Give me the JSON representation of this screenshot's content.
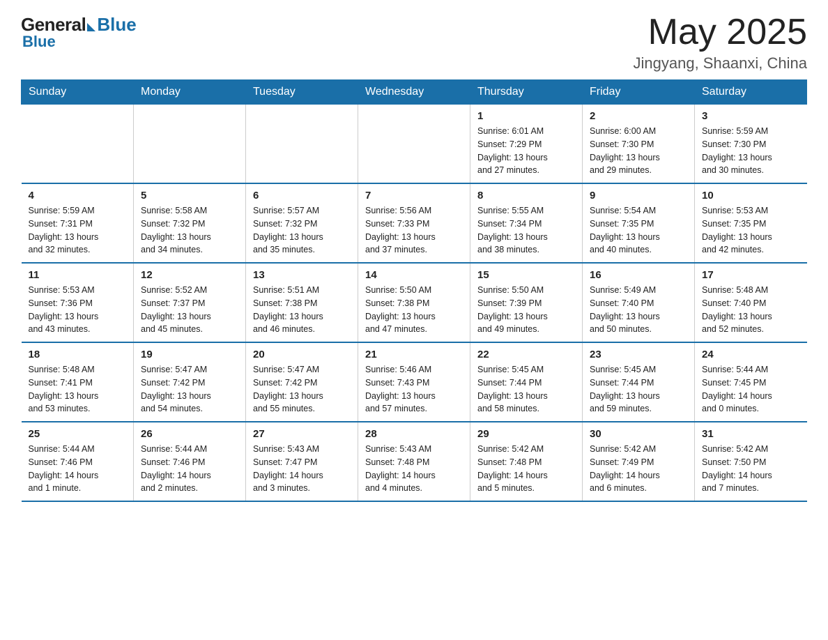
{
  "header": {
    "logo_general": "General",
    "logo_blue": "Blue",
    "month_year": "May 2025",
    "location": "Jingyang, Shaanxi, China"
  },
  "weekdays": [
    "Sunday",
    "Monday",
    "Tuesday",
    "Wednesday",
    "Thursday",
    "Friday",
    "Saturday"
  ],
  "weeks": [
    [
      {
        "day": "",
        "info": ""
      },
      {
        "day": "",
        "info": ""
      },
      {
        "day": "",
        "info": ""
      },
      {
        "day": "",
        "info": ""
      },
      {
        "day": "1",
        "info": "Sunrise: 6:01 AM\nSunset: 7:29 PM\nDaylight: 13 hours\nand 27 minutes."
      },
      {
        "day": "2",
        "info": "Sunrise: 6:00 AM\nSunset: 7:30 PM\nDaylight: 13 hours\nand 29 minutes."
      },
      {
        "day": "3",
        "info": "Sunrise: 5:59 AM\nSunset: 7:30 PM\nDaylight: 13 hours\nand 30 minutes."
      }
    ],
    [
      {
        "day": "4",
        "info": "Sunrise: 5:59 AM\nSunset: 7:31 PM\nDaylight: 13 hours\nand 32 minutes."
      },
      {
        "day": "5",
        "info": "Sunrise: 5:58 AM\nSunset: 7:32 PM\nDaylight: 13 hours\nand 34 minutes."
      },
      {
        "day": "6",
        "info": "Sunrise: 5:57 AM\nSunset: 7:32 PM\nDaylight: 13 hours\nand 35 minutes."
      },
      {
        "day": "7",
        "info": "Sunrise: 5:56 AM\nSunset: 7:33 PM\nDaylight: 13 hours\nand 37 minutes."
      },
      {
        "day": "8",
        "info": "Sunrise: 5:55 AM\nSunset: 7:34 PM\nDaylight: 13 hours\nand 38 minutes."
      },
      {
        "day": "9",
        "info": "Sunrise: 5:54 AM\nSunset: 7:35 PM\nDaylight: 13 hours\nand 40 minutes."
      },
      {
        "day": "10",
        "info": "Sunrise: 5:53 AM\nSunset: 7:35 PM\nDaylight: 13 hours\nand 42 minutes."
      }
    ],
    [
      {
        "day": "11",
        "info": "Sunrise: 5:53 AM\nSunset: 7:36 PM\nDaylight: 13 hours\nand 43 minutes."
      },
      {
        "day": "12",
        "info": "Sunrise: 5:52 AM\nSunset: 7:37 PM\nDaylight: 13 hours\nand 45 minutes."
      },
      {
        "day": "13",
        "info": "Sunrise: 5:51 AM\nSunset: 7:38 PM\nDaylight: 13 hours\nand 46 minutes."
      },
      {
        "day": "14",
        "info": "Sunrise: 5:50 AM\nSunset: 7:38 PM\nDaylight: 13 hours\nand 47 minutes."
      },
      {
        "day": "15",
        "info": "Sunrise: 5:50 AM\nSunset: 7:39 PM\nDaylight: 13 hours\nand 49 minutes."
      },
      {
        "day": "16",
        "info": "Sunrise: 5:49 AM\nSunset: 7:40 PM\nDaylight: 13 hours\nand 50 minutes."
      },
      {
        "day": "17",
        "info": "Sunrise: 5:48 AM\nSunset: 7:40 PM\nDaylight: 13 hours\nand 52 minutes."
      }
    ],
    [
      {
        "day": "18",
        "info": "Sunrise: 5:48 AM\nSunset: 7:41 PM\nDaylight: 13 hours\nand 53 minutes."
      },
      {
        "day": "19",
        "info": "Sunrise: 5:47 AM\nSunset: 7:42 PM\nDaylight: 13 hours\nand 54 minutes."
      },
      {
        "day": "20",
        "info": "Sunrise: 5:47 AM\nSunset: 7:42 PM\nDaylight: 13 hours\nand 55 minutes."
      },
      {
        "day": "21",
        "info": "Sunrise: 5:46 AM\nSunset: 7:43 PM\nDaylight: 13 hours\nand 57 minutes."
      },
      {
        "day": "22",
        "info": "Sunrise: 5:45 AM\nSunset: 7:44 PM\nDaylight: 13 hours\nand 58 minutes."
      },
      {
        "day": "23",
        "info": "Sunrise: 5:45 AM\nSunset: 7:44 PM\nDaylight: 13 hours\nand 59 minutes."
      },
      {
        "day": "24",
        "info": "Sunrise: 5:44 AM\nSunset: 7:45 PM\nDaylight: 14 hours\nand 0 minutes."
      }
    ],
    [
      {
        "day": "25",
        "info": "Sunrise: 5:44 AM\nSunset: 7:46 PM\nDaylight: 14 hours\nand 1 minute."
      },
      {
        "day": "26",
        "info": "Sunrise: 5:44 AM\nSunset: 7:46 PM\nDaylight: 14 hours\nand 2 minutes."
      },
      {
        "day": "27",
        "info": "Sunrise: 5:43 AM\nSunset: 7:47 PM\nDaylight: 14 hours\nand 3 minutes."
      },
      {
        "day": "28",
        "info": "Sunrise: 5:43 AM\nSunset: 7:48 PM\nDaylight: 14 hours\nand 4 minutes."
      },
      {
        "day": "29",
        "info": "Sunrise: 5:42 AM\nSunset: 7:48 PM\nDaylight: 14 hours\nand 5 minutes."
      },
      {
        "day": "30",
        "info": "Sunrise: 5:42 AM\nSunset: 7:49 PM\nDaylight: 14 hours\nand 6 minutes."
      },
      {
        "day": "31",
        "info": "Sunrise: 5:42 AM\nSunset: 7:50 PM\nDaylight: 14 hours\nand 7 minutes."
      }
    ]
  ]
}
